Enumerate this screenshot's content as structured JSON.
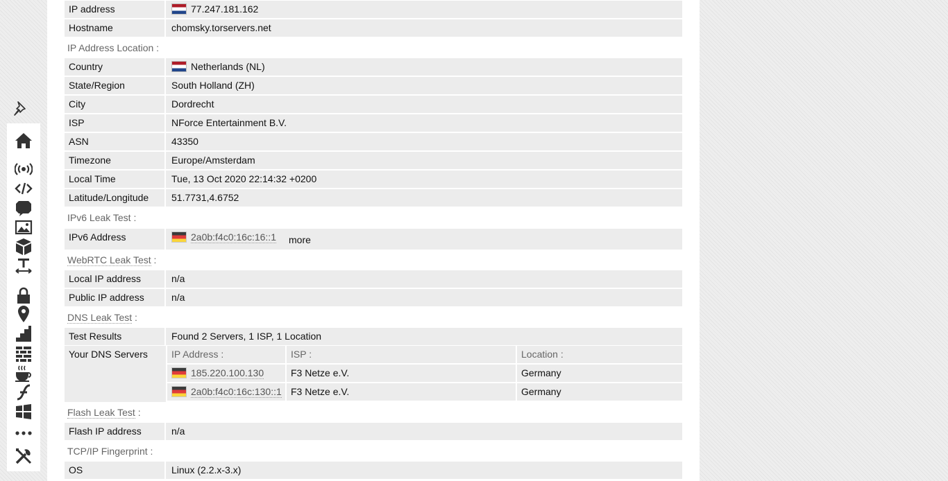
{
  "rows": {
    "ip_address": {
      "label": "IP address",
      "value": "77.247.181.162",
      "flag": "nl"
    },
    "hostname": {
      "label": "Hostname",
      "value": "chomsky.torservers.net"
    }
  },
  "sections": {
    "ip_location": "IP Address Location :",
    "ipv6": "IPv6 Leak Test :",
    "webrtc_link": "WebRTC Leak Test",
    "dns_link": "DNS Leak Test",
    "flash_link": "Flash Leak Test",
    "tcp": "TCP/IP Fingerprint :",
    "colon": ":"
  },
  "location": {
    "country": {
      "label": "Country",
      "value": "Netherlands (NL)",
      "flag": "nl"
    },
    "state": {
      "label": "State/Region",
      "value": "South Holland (ZH)"
    },
    "city": {
      "label": "City",
      "value": "Dordrecht"
    },
    "isp": {
      "label": "ISP",
      "value": "NForce Entertainment B.V."
    },
    "asn": {
      "label": "ASN",
      "value": "43350"
    },
    "timezone": {
      "label": "Timezone",
      "value": "Europe/Amsterdam"
    },
    "local_time": {
      "label": "Local Time",
      "value": "Tue, 13 Oct 2020 22:14:32 +0200"
    },
    "latlong": {
      "label": "Latitude/Longitude",
      "value": "51.7731,4.6752"
    }
  },
  "ipv6": {
    "label": "IPv6 Address",
    "value": "2a0b:f4c0:16c:16::1",
    "flag": "de",
    "more": "more"
  },
  "webrtc": {
    "local": {
      "label": "Local IP address",
      "value": "n/a"
    },
    "public": {
      "label": "Public IP address",
      "value": "n/a"
    }
  },
  "dns": {
    "results_label": "Test Results",
    "results_value": "Found 2 Servers, 1 ISP, 1 Location",
    "servers_label": "Your DNS Servers",
    "headers": {
      "ip": "IP Address :",
      "isp": "ISP :",
      "location": "Location :"
    },
    "servers": [
      {
        "ip": "185.220.100.130",
        "isp": "F3 Netze e.V.",
        "location": "Germany",
        "flag": "de"
      },
      {
        "ip": "2a0b:f4c0:16c:130::1",
        "isp": "F3 Netze e.V.",
        "location": "Germany",
        "flag": "de"
      }
    ]
  },
  "flash": {
    "label": "Flash IP address",
    "value": "n/a"
  },
  "tcp": {
    "label": "OS",
    "value": "Linux (2.2.x-3.x)"
  },
  "sidebar_icons": [
    "pin-icon",
    "home-icon",
    "broadcast-icon",
    "code-icon",
    "chat-icon",
    "image-icon",
    "cube-icon",
    "text-width-icon",
    "lock-icon",
    "location-pin-icon",
    "stairs-icon",
    "firewall-icon",
    "coffee-icon",
    "flash-icon",
    "windows-icon",
    "more-icon",
    "tools-icon"
  ],
  "colors": {
    "row_bg": "#ececec",
    "page_bg": "#eeeeee",
    "label_gray": "#666666"
  }
}
